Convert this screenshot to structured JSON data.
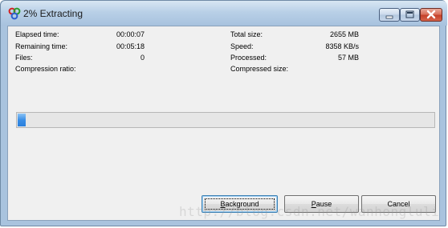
{
  "window": {
    "title": "2% Extracting",
    "icon": "app-icon"
  },
  "title_controls": [
    "minimize-icon",
    "maximize-icon",
    "close-icon"
  ],
  "stats_left": [
    {
      "label": "Elapsed time:",
      "value": "00:00:07"
    },
    {
      "label": "Remaining time:",
      "value": "00:05:18"
    },
    {
      "label": "Files:",
      "value": "0"
    },
    {
      "label": "Compression ratio:",
      "value": ""
    }
  ],
  "stats_right": [
    {
      "label": "Total size:",
      "value": "2655 MB"
    },
    {
      "label": "Speed:",
      "value": "8358 KB/s"
    },
    {
      "label": "Processed:",
      "value": "57 MB"
    },
    {
      "label": "Compressed size:",
      "value": ""
    }
  ],
  "progress": {
    "fraction": 0.02
  },
  "buttons": {
    "background": {
      "pre": "",
      "hot": "B",
      "post": "ackground"
    },
    "pause": {
      "pre": "",
      "hot": "P",
      "post": "ause"
    },
    "cancel": {
      "label": "Cancel"
    }
  },
  "watermark": "http://blog.csdn.net/wanhongluli",
  "colors": {
    "title_bg": "#b9d0e7",
    "client_bg": "#f0f0f0",
    "progress_fill": "#2a7fdc",
    "close_button": "#c5412a"
  }
}
